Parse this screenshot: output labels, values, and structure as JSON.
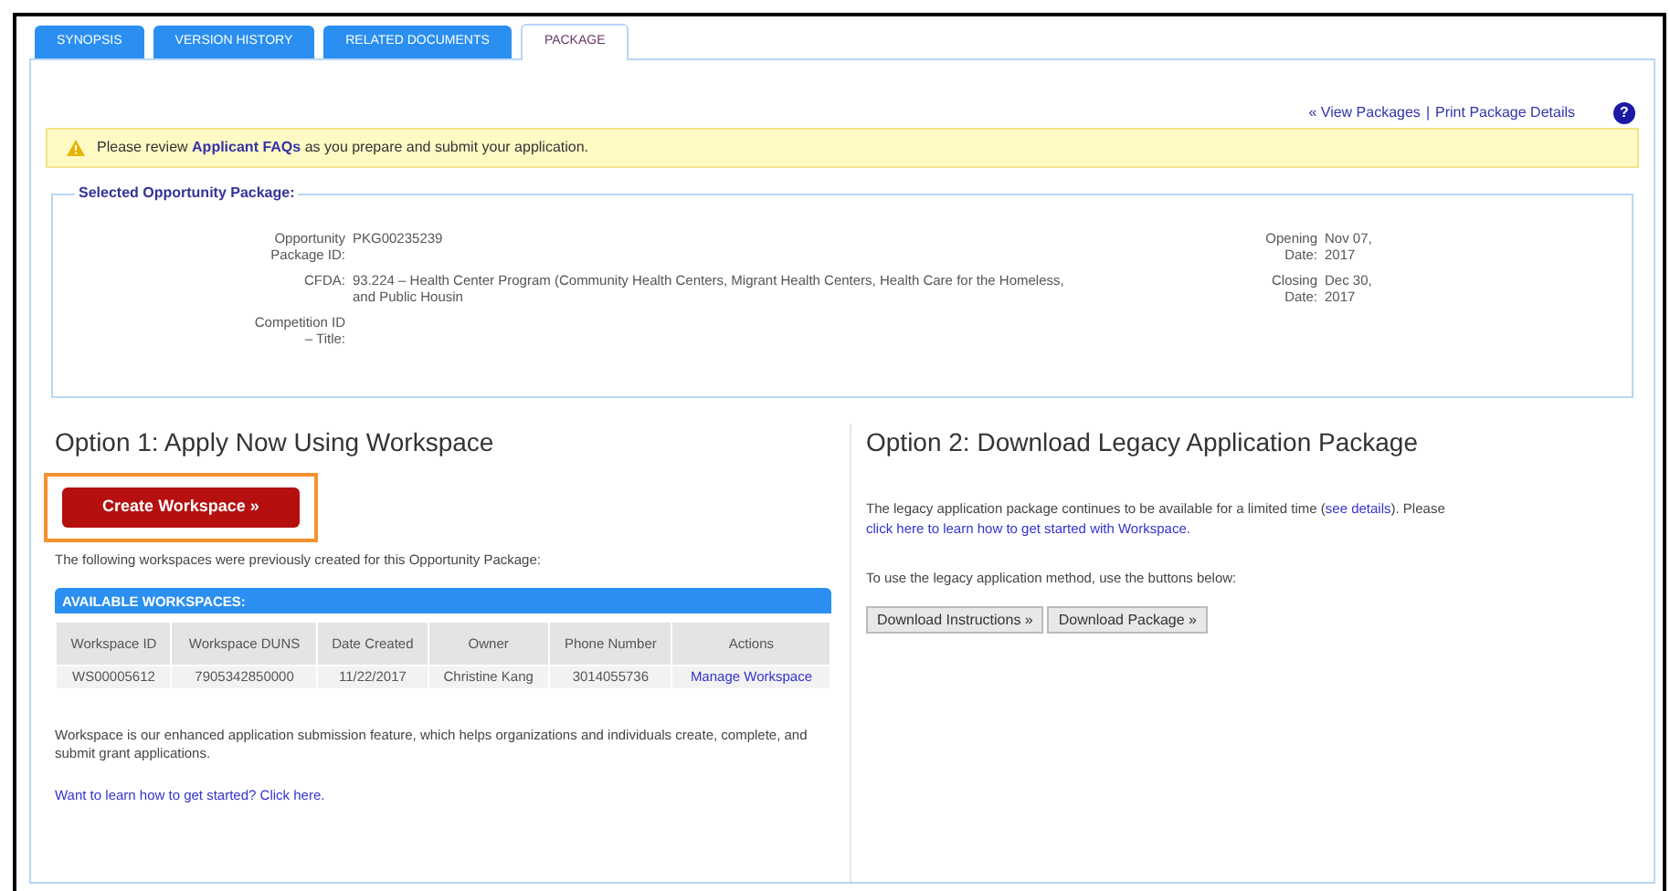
{
  "tabs": [
    {
      "label": "SYNOPSIS",
      "selected": false
    },
    {
      "label": "VERSION HISTORY",
      "selected": false
    },
    {
      "label": "RELATED DOCUMENTS",
      "selected": false
    },
    {
      "label": "PACKAGE",
      "selected": true
    }
  ],
  "top_links": {
    "view_packages": "« View Packages",
    "separator": "|",
    "print": "Print Package Details",
    "help": "?"
  },
  "alert": {
    "segments": [
      {
        "kind": "text",
        "text": "Please review "
      },
      {
        "kind": "link",
        "text": "Applicant FAQs"
      },
      {
        "kind": "text",
        "text": " as you prepare and submit your application."
      }
    ]
  },
  "package": {
    "legend": "Selected Opportunity Package:",
    "fields": [
      {
        "label": "Opportunity Package ID:",
        "value": "PKG00235239"
      },
      {
        "label": "CFDA:",
        "value": "93.224 – Health Center Program (Community Health Centers, Migrant Health Centers, Health Care for the Homeless, and Public Housin"
      },
      {
        "label": "Competition ID – Title:"
      }
    ],
    "dates": [
      {
        "label": "Opening Date:",
        "value": "Nov 07, 2017"
      },
      {
        "label": "Closing Date:",
        "value": "Dec 30, 2017"
      }
    ]
  },
  "option_1": {
    "heading": "Option 1: Apply Now Using Workspace",
    "button": "Create Workspace »",
    "highlighted": true,
    "intro": "The following workspaces were previously created for this Opportunity Package:",
    "table": {
      "title": "AVAILABLE WORKSPACES:",
      "columns": [
        "Workspace ID",
        "Workspace DUNS",
        "Date Created",
        "Owner",
        "Phone Number",
        "Actions"
      ],
      "rows": [
        {
          "cells": [
            "WS00005612",
            "7905342850000",
            "11/22/2017",
            "Christine Kang",
            "3014055736"
          ],
          "action": "Manage Workspace"
        }
      ]
    },
    "description": "Workspace is our enhanced application submission feature, which helps organizations and individuals create, complete, and submit grant applications.",
    "help_link": "Want to learn how to get started? Click here."
  },
  "option_2": {
    "heading": "Option 2: Download Legacy Application Package",
    "segments": [
      {
        "kind": "text",
        "text": "The legacy application package continues to be available for a limited time ("
      },
      {
        "kind": "link",
        "text": "see details"
      },
      {
        "kind": "text",
        "text": "). Please "
      },
      {
        "kind": "link",
        "text": "click here to learn how to get started with Workspace."
      }
    ],
    "instruction": "To use the legacy application method, use the buttons below:",
    "buttons": [
      "Download Instructions »",
      "Download Package »"
    ]
  }
}
